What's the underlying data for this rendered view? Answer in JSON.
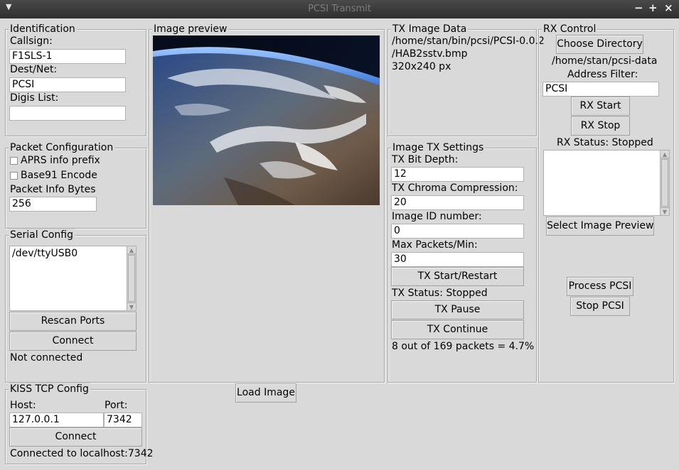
{
  "window": {
    "title": "PCSI Transmit",
    "menu_icon": "triangle-down-icon",
    "minimize_glyph": "−",
    "maximize_glyph": "+",
    "close_glyph": "×"
  },
  "identification": {
    "title": "Identification",
    "callsign_label": "Callsign:",
    "callsign_value": "F1SLS-1",
    "dest_label": "Dest/Net:",
    "dest_value": "PCSI",
    "digis_label": "Digis List:",
    "digis_value": ""
  },
  "packet_config": {
    "title": "Packet Configuration",
    "aprs_label": "APRS info prefix",
    "aprs_checked": false,
    "base91_label": "Base91 Encode",
    "base91_checked": false,
    "info_bytes_label": "Packet Info Bytes",
    "info_bytes_value": "256"
  },
  "serial_config": {
    "title": "Serial Config",
    "ports": [
      "/dev/ttyUSB0"
    ],
    "rescan_label": "Rescan Ports",
    "connect_label": "Connect",
    "status": "Not connected"
  },
  "kiss_tcp": {
    "title": "KISS TCP Config",
    "host_label": "Host:",
    "host_value": "127.0.0.1",
    "port_label": "Port:",
    "port_value": "7342",
    "connect_label": "Connect",
    "status": "Connected to localhost:7342"
  },
  "image_preview": {
    "title": "Image preview",
    "load_label": "Load Image"
  },
  "tx_image_data": {
    "title": "TX Image Data",
    "path_line1": "/home/stan/bin/pcsi/PCSI-0.0.2",
    "path_line2": "/HAB2sstv.bmp",
    "dimensions": "320x240 px"
  },
  "image_tx_settings": {
    "title": "Image TX Settings",
    "bit_depth_label": "TX Bit Depth:",
    "bit_depth_value": "12",
    "chroma_label": "TX Chroma Compression:",
    "chroma_value": "20",
    "image_id_label": "Image ID number:",
    "image_id_value": "0",
    "max_packets_label": "Max Packets/Min:",
    "max_packets_value": "30",
    "start_label": "TX Start/Restart",
    "status": "TX Status: Stopped",
    "pause_label": "TX Pause",
    "continue_label": "TX Continue",
    "progress": "8 out of 169 packets = 4.7%"
  },
  "rx_control": {
    "title": "RX Control",
    "choose_dir_label": "Choose Directory",
    "directory": "/home/stan/pcsi-data",
    "filter_label": "Address Filter:",
    "filter_value": "PCSI",
    "rx_start_label": "RX Start",
    "rx_stop_label": "RX Stop",
    "status": "RX Status: Stopped",
    "select_preview_label": "Select Image Preview",
    "process_label": "Process PCSI",
    "stop_pcsi_label": "Stop PCSI"
  }
}
